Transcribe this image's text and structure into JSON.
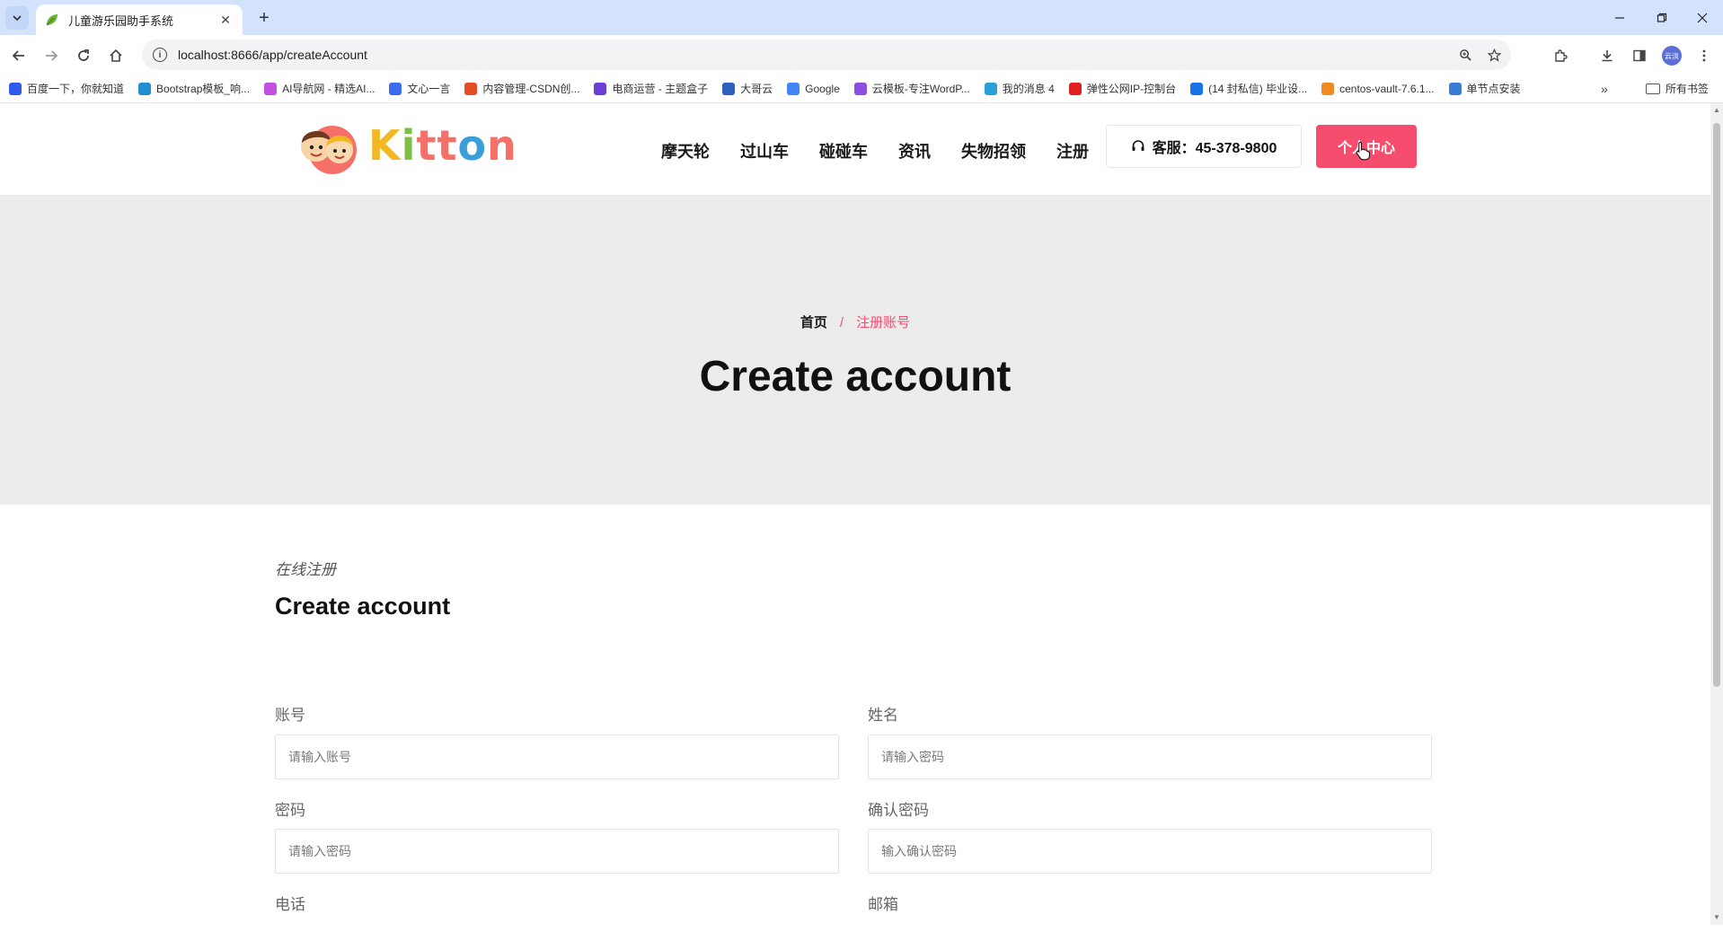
{
  "browser": {
    "tab_title": "儿童游乐园助手系统",
    "url": "localhost:8666/app/createAccount",
    "profile_label": "云淡",
    "bookmarks": [
      {
        "label": "百度一下，你就知道",
        "color": "#2f5bea"
      },
      {
        "label": "Bootstrap模板_响...",
        "color": "#1f8fd1"
      },
      {
        "label": "AI导航网 - 精选AI...",
        "color": "#c44fe0"
      },
      {
        "label": "文心一言",
        "color": "#3b6cf0"
      },
      {
        "label": "内容管理-CSDN创...",
        "color": "#e44d26"
      },
      {
        "label": "电商运营 - 主题盒子",
        "color": "#6a3fd6"
      },
      {
        "label": "大哥云",
        "color": "#2e5fbf"
      },
      {
        "label": "Google",
        "color": "#4285f4"
      },
      {
        "label": "云模板-专注WordP...",
        "color": "#8a4fe0"
      },
      {
        "label": "我的消息 4",
        "color": "#2aa0d8"
      },
      {
        "label": "弹性公网IP-控制台",
        "color": "#e02020"
      },
      {
        "label": "(14 封私信) 毕业设...",
        "color": "#1773ea"
      },
      {
        "label": "centos-vault-7.6.1...",
        "color": "#f08a24"
      },
      {
        "label": "单节点安装",
        "color": "#3a7bd5"
      }
    ],
    "bookmarks_folder": "所有书签"
  },
  "site": {
    "logo_text": "Kitton",
    "nav": [
      "摩天轮",
      "过山车",
      "碰碰车",
      "资讯",
      "失物招领",
      "注册"
    ],
    "phone": "客服：45-378-9800",
    "center_button": "个人中心",
    "accent": "#f64c6d"
  },
  "hero": {
    "breadcrumb_home": "首页",
    "breadcrumb_sep": "/",
    "breadcrumb_current": "注册账号",
    "title": "Create account"
  },
  "form": {
    "subtitle": "在线注册",
    "title": "Create account",
    "fields": [
      {
        "label": "账号",
        "placeholder": "请输入账号"
      },
      {
        "label": "姓名",
        "placeholder": "请输入密码"
      },
      {
        "label": "密码",
        "placeholder": "请输入密码"
      },
      {
        "label": "确认密码",
        "placeholder": "输入确认密码"
      },
      {
        "label": "电话",
        "placeholder": ""
      },
      {
        "label": "邮箱",
        "placeholder": ""
      }
    ]
  }
}
